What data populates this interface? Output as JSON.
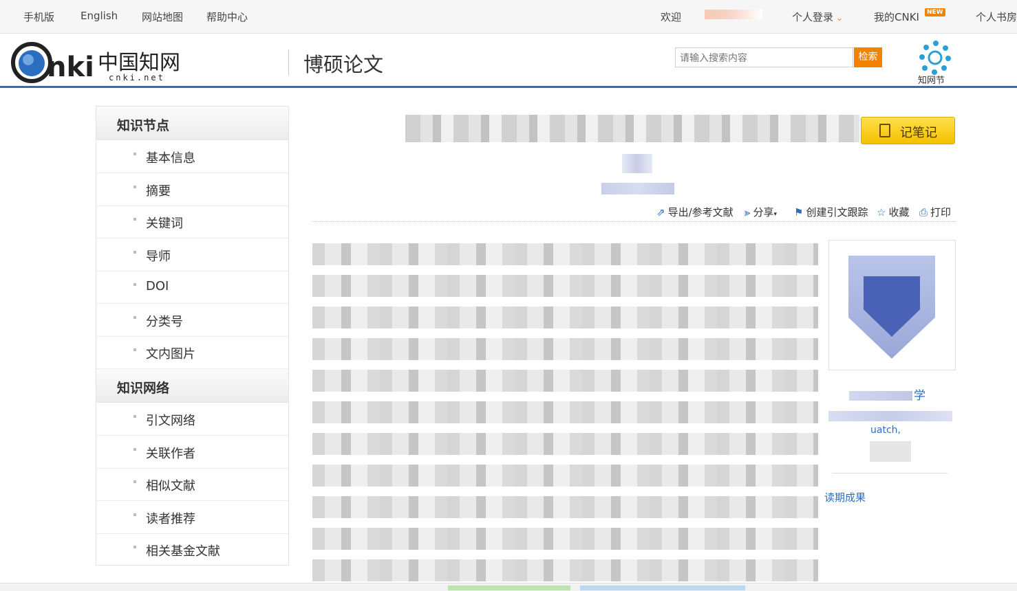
{
  "topbar": {
    "mobile": "手机版",
    "english": "English",
    "sitemap": "网站地图",
    "help": "帮助中心",
    "welcome": "欢迎",
    "login": "个人登录",
    "my_cnki": "我的CNKI",
    "new_badge": "NEW",
    "bookroom": "个人书房"
  },
  "header": {
    "logo_text": "CNKi中国知网",
    "logo_sub": "cnki.net",
    "db_title": "博硕论文",
    "search_placeholder": "请输入搜索内容",
    "search_button": "检索",
    "zhiwang_jie": "知网节"
  },
  "sidebar": {
    "section1_title": "知识节点",
    "section1_items": [
      "基本信息",
      "摘要",
      "关键词",
      "导师",
      "DOI",
      "分类号",
      "文内图片"
    ],
    "section2_title": "知识网络",
    "section2_items": [
      "引文网络",
      "关联作者",
      "相似文献",
      "读者推荐",
      "相关基金文献"
    ]
  },
  "main": {
    "note_button": "记笔记",
    "toolbar": {
      "export": "导出/参考文献",
      "share": "分享",
      "track": "创建引文跟踪",
      "favorite": "收藏",
      "print": "打印"
    },
    "school_name_tail": "学",
    "school_sub_text": "uatch,",
    "periodic_link": "读期成果"
  },
  "colors": {
    "accent": "#f08300",
    "brand_blue": "#2a6ebd",
    "note_yellow": "#f4c000"
  }
}
